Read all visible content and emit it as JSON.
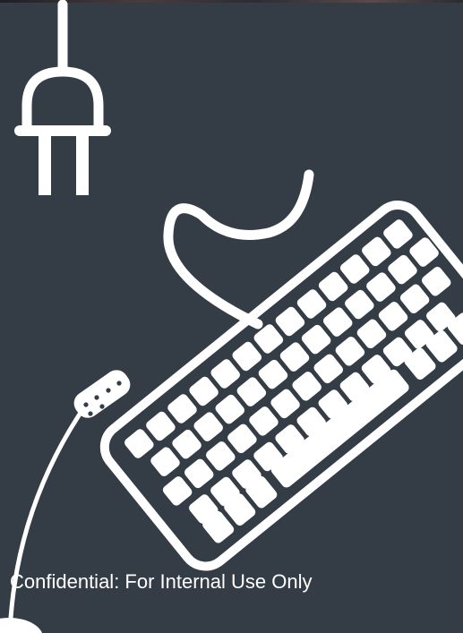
{
  "colors": {
    "background": "#343c46",
    "illustration": "#ffffff"
  },
  "illustration": {
    "objects": [
      "power-plug-icon",
      "keyboard-icon",
      "mouse-cable-icon"
    ]
  },
  "watermark": {
    "text": "Confidential: For Internal Use Only"
  }
}
